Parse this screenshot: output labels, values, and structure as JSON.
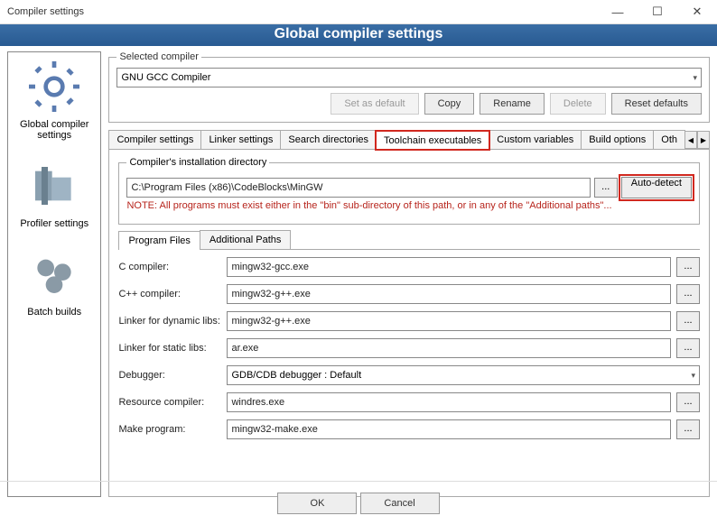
{
  "titlebar": {
    "title": "Compiler settings"
  },
  "banner": "Global compiler settings",
  "sidebar": {
    "items": [
      {
        "label": "Global compiler settings"
      },
      {
        "label": "Profiler settings"
      },
      {
        "label": "Batch builds"
      }
    ]
  },
  "selected_compiler": {
    "legend": "Selected compiler",
    "value": "GNU GCC Compiler",
    "buttons": {
      "set_default": "Set as default",
      "copy": "Copy",
      "rename": "Rename",
      "delete": "Delete",
      "reset": "Reset defaults"
    }
  },
  "tabs": {
    "items": [
      "Compiler settings",
      "Linker settings",
      "Search directories",
      "Toolchain executables",
      "Custom variables",
      "Build options",
      "Oth"
    ],
    "active_index": 3
  },
  "install_dir": {
    "legend": "Compiler's installation directory",
    "path": "C:\\Program Files (x86)\\CodeBlocks\\MinGW",
    "browse": "...",
    "auto_detect": "Auto-detect",
    "note": "NOTE: All programs must exist either in the \"bin\" sub-directory of this path, or in any of the \"Additional paths\"..."
  },
  "subtabs": [
    "Program Files",
    "Additional Paths"
  ],
  "program_files": {
    "rows": [
      {
        "label": "C compiler:",
        "value": "mingw32-gcc.exe"
      },
      {
        "label": "C++ compiler:",
        "value": "mingw32-g++.exe"
      },
      {
        "label": "Linker for dynamic libs:",
        "value": "mingw32-g++.exe"
      },
      {
        "label": "Linker for static libs:",
        "value": "ar.exe"
      },
      {
        "label": "Debugger:",
        "value": "GDB/CDB debugger : Default",
        "dropdown": true
      },
      {
        "label": "Resource compiler:",
        "value": "windres.exe"
      },
      {
        "label": "Make program:",
        "value": "mingw32-make.exe"
      }
    ]
  },
  "footer": {
    "ok": "OK",
    "cancel": "Cancel"
  }
}
